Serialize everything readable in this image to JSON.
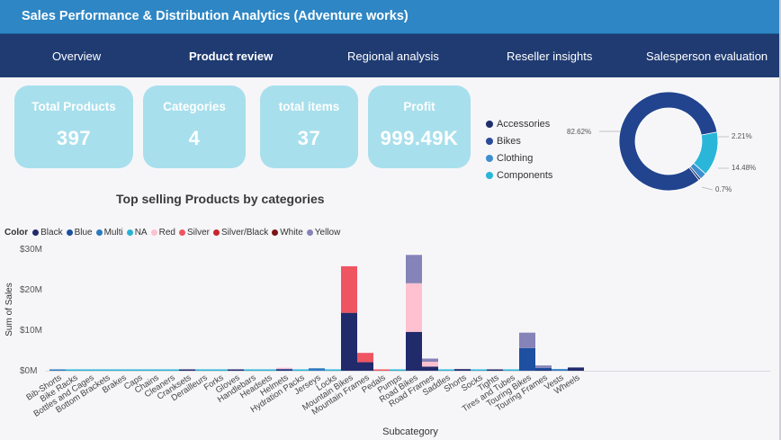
{
  "header": {
    "title": "Sales Performance & Distribution Analytics (Adventure works)"
  },
  "nav": {
    "tabs": [
      {
        "label": "Overview",
        "active": false
      },
      {
        "label": "Product review",
        "active": true
      },
      {
        "label": "Regional analysis",
        "active": false
      },
      {
        "label": "Reseller insights",
        "active": false
      },
      {
        "label": "Salesperson evaluation",
        "active": false
      }
    ]
  },
  "kpis": [
    {
      "label": "Total Products",
      "value": "397"
    },
    {
      "label": "Categories",
      "value": "4"
    },
    {
      "label": "total items",
      "value": "37"
    },
    {
      "label": "Profit",
      "value": "999.49K"
    }
  ],
  "category_legend": {
    "items": [
      {
        "label": "Accessories",
        "color": "#1e2f6b"
      },
      {
        "label": "Bikes",
        "color": "#2a4b99"
      },
      {
        "label": "Clothing",
        "color": "#3d8fd0"
      },
      {
        "label": "Components",
        "color": "#29b6d8"
      }
    ]
  },
  "color_legend": {
    "label": "Color",
    "items": [
      {
        "label": "Black",
        "color": "#212a6b"
      },
      {
        "label": "Blue",
        "color": "#1e4fa0"
      },
      {
        "label": "Multi",
        "color": "#2b7ac0"
      },
      {
        "label": "NA",
        "color": "#28b4d2"
      },
      {
        "label": "Red",
        "color": "#ffc1cf"
      },
      {
        "label": "Silver",
        "color": "#ef5561"
      },
      {
        "label": "Silver/Black",
        "color": "#c9262d"
      },
      {
        "label": "White",
        "color": "#7a1515"
      },
      {
        "label": "Yellow",
        "color": "#8583b8"
      }
    ]
  },
  "chart_data": [
    {
      "type": "pie",
      "subtype": "donut",
      "labels": [
        "Bikes",
        "Components",
        "Clothing",
        "Accessories"
      ],
      "values": [
        82.62,
        14.48,
        2.21,
        0.7
      ],
      "data_labels": [
        "82.62%",
        "14.48%",
        "2.21%",
        "0.7%"
      ],
      "colors": [
        "#22448f",
        "#29b6d8",
        "#3d8fd0",
        "#1e2f6b"
      ]
    },
    {
      "type": "bar",
      "stacked": true,
      "title": "Top selling Products by categories",
      "xlabel": "Subcategory",
      "ylabel": "Sum of Sales",
      "ylim": [
        0,
        30
      ],
      "yticks": [
        "$0M",
        "$10M",
        "$20M",
        "$30M"
      ],
      "categories": [
        "Bib-Shorts",
        "Bike Racks",
        "Bottles and Cages",
        "Bottom Brackets",
        "Brakes",
        "Caps",
        "Chains",
        "Cleaners",
        "Cranksets",
        "Derailleurs",
        "Forks",
        "Gloves",
        "Handlebars",
        "Headsets",
        "Helmets",
        "Hydration Packs",
        "Jerseys",
        "Locks",
        "Mountain Bikes",
        "Mountain Frames",
        "Pedals",
        "Pumps",
        "Road Bikes",
        "Road Frames",
        "Saddles",
        "Shorts",
        "Socks",
        "Tights",
        "Tires and Tubes",
        "Touring Bikes",
        "Touring Frames",
        "Vests",
        "Wheels"
      ],
      "series": [
        {
          "name": "Black",
          "color": "#212a6b",
          "values": [
            0,
            0,
            0,
            0,
            0,
            0,
            0,
            0,
            0.3,
            0,
            0,
            0.3,
            0,
            0,
            0.2,
            0,
            0,
            0,
            14.3,
            2.1,
            0,
            0,
            9.6,
            1.0,
            0,
            0.4,
            0,
            0.2,
            0,
            0,
            0.2,
            0,
            0.8
          ]
        },
        {
          "name": "Blue",
          "color": "#1e4fa0",
          "values": [
            0,
            0,
            0,
            0,
            0,
            0,
            0,
            0,
            0,
            0,
            0,
            0,
            0,
            0,
            0.2,
            0,
            0,
            0,
            0,
            0,
            0,
            0,
            0,
            0,
            0,
            0,
            0,
            0,
            0,
            5.6,
            0.5,
            0,
            0
          ]
        },
        {
          "name": "Multi",
          "color": "#2b7ac0",
          "values": [
            0.3,
            0,
            0,
            0,
            0,
            0,
            0,
            0,
            0,
            0,
            0,
            0,
            0,
            0,
            0,
            0,
            0.6,
            0,
            0,
            0,
            0,
            0,
            0,
            0,
            0,
            0,
            0,
            0,
            0,
            0,
            0,
            0.4,
            0
          ]
        },
        {
          "name": "NA",
          "color": "#28b4d2",
          "values": [
            0,
            0.2,
            0.1,
            0.1,
            0.1,
            0.1,
            0.1,
            0.1,
            0,
            0.1,
            0.1,
            0,
            0.2,
            0.1,
            0,
            0.1,
            0,
            0.1,
            0,
            0,
            0,
            0.1,
            0,
            0,
            0.1,
            0,
            0.1,
            0,
            0.1,
            0,
            0,
            0,
            0
          ]
        },
        {
          "name": "Red",
          "color": "#ffc1cf",
          "values": [
            0,
            0,
            0,
            0,
            0,
            0,
            0,
            0,
            0,
            0,
            0,
            0,
            0,
            0,
            0.1,
            0,
            0,
            0,
            0,
            0,
            0,
            0,
            12.0,
            1.2,
            0,
            0,
            0,
            0,
            0,
            0,
            0,
            0,
            0
          ]
        },
        {
          "name": "Silver",
          "color": "#ef5561",
          "values": [
            0,
            0,
            0,
            0,
            0,
            0,
            0,
            0,
            0,
            0,
            0,
            0,
            0,
            0,
            0,
            0,
            0,
            0,
            11.5,
            2.3,
            0.3,
            0,
            0,
            0,
            0,
            0,
            0,
            0,
            0,
            0,
            0,
            0,
            0
          ]
        },
        {
          "name": "Yellow",
          "color": "#8583b8",
          "values": [
            0,
            0,
            0,
            0,
            0,
            0,
            0,
            0,
            0,
            0,
            0,
            0,
            0,
            0,
            0,
            0,
            0,
            0,
            0,
            0,
            0,
            0,
            7.0,
            0.8,
            0,
            0,
            0,
            0,
            0,
            3.8,
            0.6,
            0,
            0
          ]
        }
      ]
    }
  ]
}
